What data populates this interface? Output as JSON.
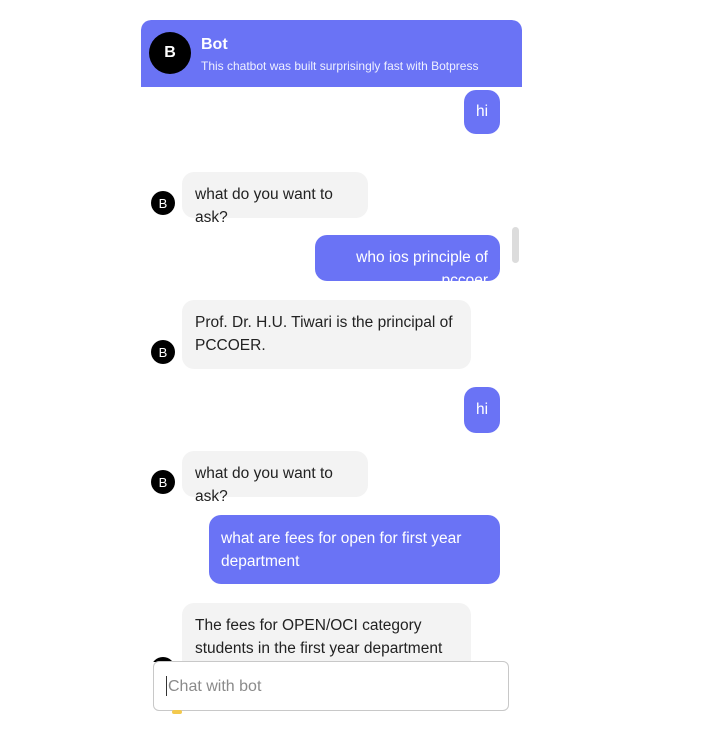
{
  "header": {
    "avatar_letter": "B",
    "title": "Bot",
    "description": "This chatbot was built surprisingly fast with Botpress"
  },
  "colors": {
    "accent": "#6a73f5",
    "bot_bubble": "#f3f3f3",
    "avatar": "#000000"
  },
  "messages": [
    {
      "role": "user",
      "text": "hi"
    },
    {
      "role": "bot",
      "text": "what do you want to ask?"
    },
    {
      "role": "user",
      "text": "who ios principle of pccoer"
    },
    {
      "role": "bot",
      "text": "Prof. Dr. H.U. Tiwari is the principal of PCCOER."
    },
    {
      "role": "user",
      "text": "hi"
    },
    {
      "role": "bot",
      "text": "what do you want to ask?"
    },
    {
      "role": "user",
      "text": "what are fees for open for first year department"
    },
    {
      "role": "bot",
      "text": "The fees for OPEN/OCI category students in the first year department are"
    }
  ],
  "bot_avatar_letter": "B",
  "composer": {
    "placeholder": "Chat with bot"
  }
}
